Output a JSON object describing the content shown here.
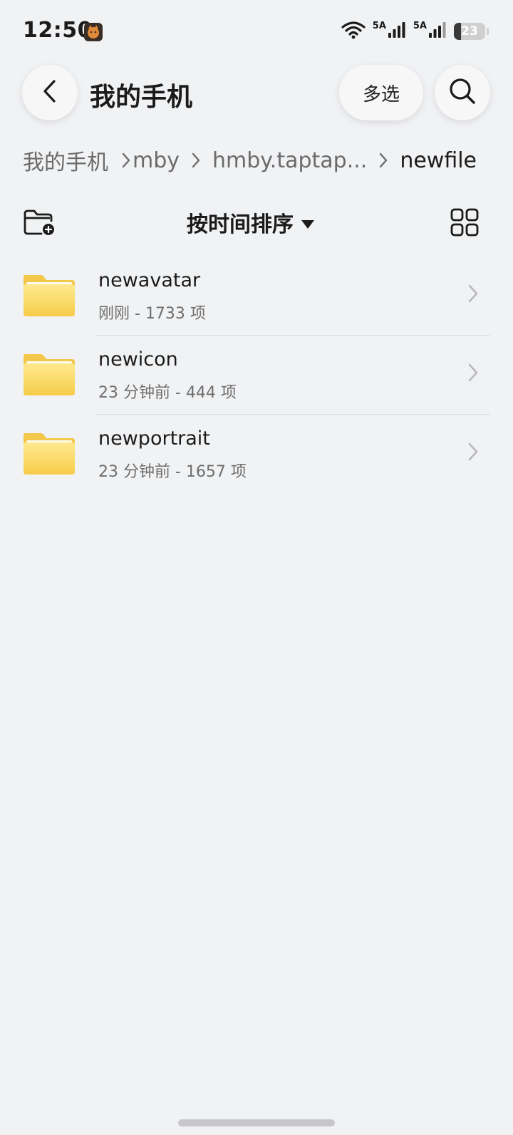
{
  "status_bar": {
    "time": "12:50",
    "network_1": "5A",
    "network_2": "5A",
    "battery_level": 23,
    "battery_text": "23",
    "icons": [
      "app-cat-icon",
      "wifi-icon",
      "signal-icon",
      "signal-icon",
      "battery-icon"
    ]
  },
  "header": {
    "title": "我的手机",
    "multi_select_label": "多选",
    "icons": [
      "chevron-left-icon",
      "search-icon"
    ]
  },
  "breadcrumb": {
    "items": [
      {
        "label": "我的手机"
      },
      {
        "label": "mby"
      },
      {
        "label": "hmby.taptap..."
      },
      {
        "label": "newfile"
      }
    ]
  },
  "toolbar": {
    "sort_label": "按时间排序",
    "icons": [
      "new-folder-icon",
      "caret-down-icon",
      "grid-view-icon"
    ]
  },
  "files": [
    {
      "name": "newavatar",
      "meta": "刚刚 - 1733 项"
    },
    {
      "name": "newicon",
      "meta": "23 分钟前 - 444 项"
    },
    {
      "name": "newportrait",
      "meta": "23 分钟前 - 1657 项"
    }
  ],
  "colors": {
    "background": "#f1f2f4",
    "folder_top": "#ffe58a",
    "folder_bottom": "#f7cf4d",
    "text_primary": "#1b1b1b",
    "text_secondary": "#6e6e6e"
  }
}
